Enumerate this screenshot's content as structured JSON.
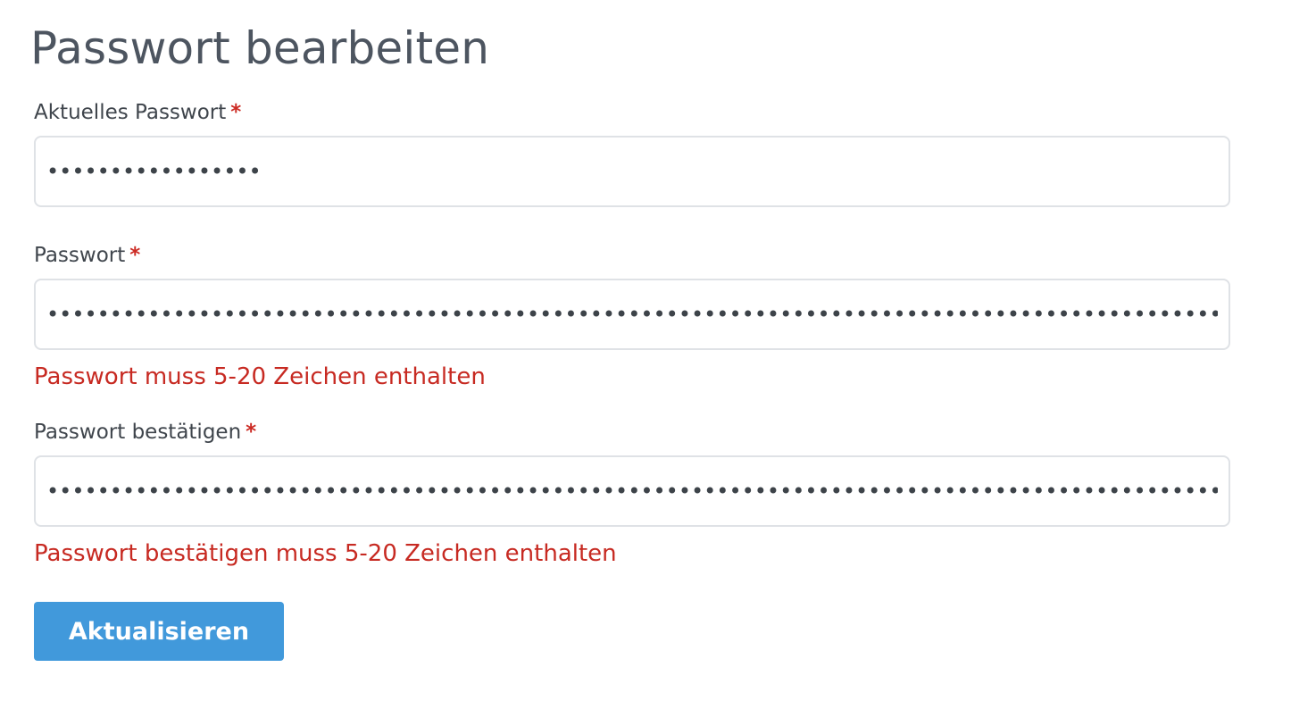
{
  "page_title": "Passwort bearbeiten",
  "required_marker": "*",
  "fields": {
    "current_password": {
      "label": "Aktuelles Passwort",
      "value": "abcdefghijklmnopq"
    },
    "password": {
      "label": "Passwort",
      "value": "abcdefghijklmnopqrstuvwxyzabcdefghijklmnopqrstuvwxyzabcdefghijklmnopqrstuvwxyzabcdefghijklmnopqrstuvwxyzabcdefghijklmnopqrstuvwxyz",
      "error": "Passwort muss 5-20 Zeichen enthalten"
    },
    "password_confirm": {
      "label": "Passwort bestätigen",
      "value": "abcdefghijklmnopqrstuvwxyzabcdefghijklmnopqrstuvwxyzabcdefghijklmnopqrstuvwxyzabcdefghijklmnopqrstuvwxyzabcdefghijklmnopqrstuvwxyz",
      "error": "Passwort bestätigen muss 5-20 Zeichen enthalten"
    }
  },
  "submit_label": "Aktualisieren",
  "colors": {
    "accent": "#4199db",
    "error": "#c72a22",
    "required": "#cc2b24",
    "input_border": "#dfe2e6"
  }
}
